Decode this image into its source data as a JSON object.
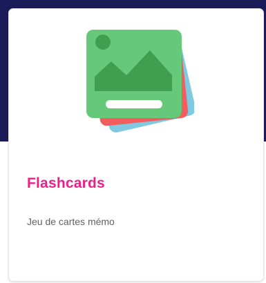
{
  "colors": {
    "backdrop": "#1b1b5a",
    "title": "#ee1f8a",
    "card_green": "#66c879",
    "card_green_dark": "#3f9f4f",
    "card_red": "#f25d5d",
    "card_blue": "#7fc9e3"
  },
  "card": {
    "icon": "flashcards-image-icon",
    "title": "Flashcards",
    "description": "Jeu de cartes mémo"
  }
}
